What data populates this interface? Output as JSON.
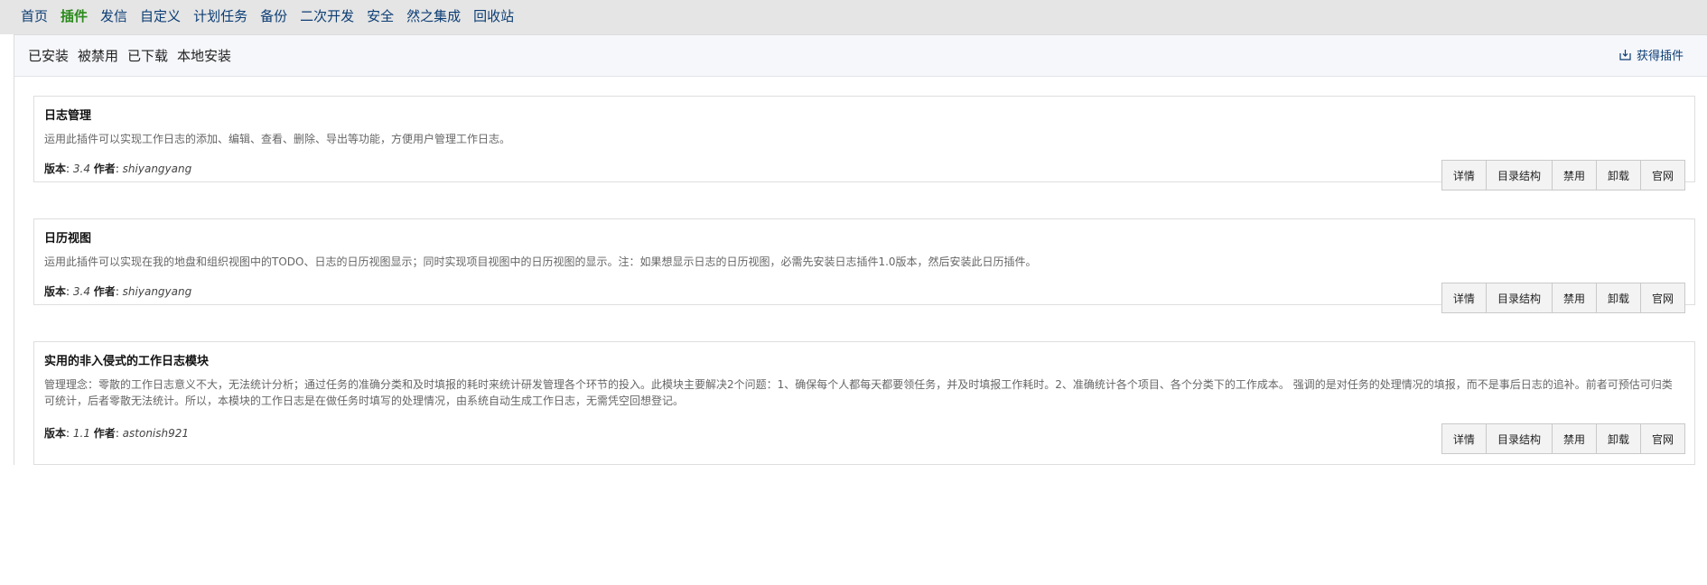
{
  "top_nav": [
    "首页",
    "插件",
    "发信",
    "自定义",
    "计划任务",
    "备份",
    "二次开发",
    "安全",
    "然之集成",
    "回收站"
  ],
  "sub_tabs": [
    "已安装",
    "被禁用",
    "已下载",
    "本地安装"
  ],
  "get_plugin_label": "获得插件",
  "labels": {
    "version": "版本",
    "author": "作者"
  },
  "plugins": [
    {
      "title": "日志管理",
      "description": "运用此插件可以实现工作日志的添加、编辑、查看、删除、导出等功能，方便用户管理工作日志。",
      "version": "3.4",
      "author": "shiyangyang",
      "actions": [
        "详情",
        "目录结构",
        "禁用",
        "卸载",
        "官网"
      ]
    },
    {
      "title": "日历视图",
      "description": "运用此插件可以实现在我的地盘和组织视图中的TODO、日志的日历视图显示；同时实现项目视图中的日历视图的显示。注：如果想显示日志的日历视图，必需先安装日志插件1.0版本，然后安装此日历插件。",
      "version": "3.4",
      "author": "shiyangyang",
      "actions": [
        "详情",
        "目录结构",
        "禁用",
        "卸载",
        "官网"
      ]
    },
    {
      "title": "实用的非入侵式的工作日志模块",
      "description": "管理理念：零散的工作日志意义不大，无法统计分析；通过任务的准确分类和及时填报的耗时来统计研发管理各个环节的投入。此模块主要解决2个问题：1、确保每个人都每天都要领任务，并及时填报工作耗时。2、准确统计各个项目、各个分类下的工作成本。 强调的是对任务的处理情况的填报，而不是事后日志的追补。前者可预估可归类可统计，后者零散无法统计。所以，本模块的工作日志是在做任务时填写的处理情况，由系统自动生成工作日志，无需凭空回想登记。",
      "version": "1.1",
      "author": "astonish921",
      "actions": [
        "详情",
        "目录结构",
        "禁用",
        "卸载",
        "官网"
      ]
    }
  ]
}
